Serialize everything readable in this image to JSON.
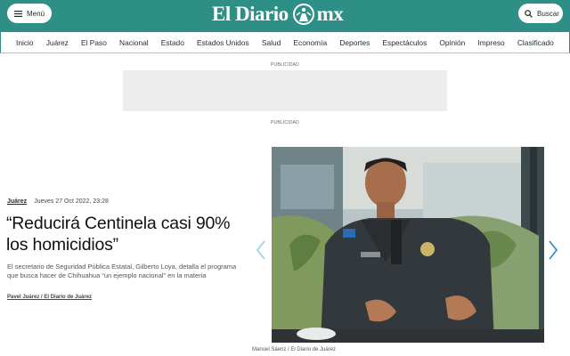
{
  "header": {
    "menu_label": "Menú",
    "search_label": "Buscar",
    "logo_left": "El Diario",
    "logo_right": "mx"
  },
  "nav": {
    "items": [
      "Inicio",
      "Juárez",
      "El Paso",
      "Nacional",
      "Estado",
      "Estados Unidos",
      "Salud",
      "Economía",
      "Deportes",
      "Espectáculos",
      "Opinión",
      "Impreso",
      "Clasificado"
    ]
  },
  "ads": {
    "label_top": "PUBLICIDAD",
    "label_bottom": "PUBLICIDAD"
  },
  "article": {
    "section": "Juárez",
    "date": "Jueves 27 Oct 2022, 23:28",
    "headline": "“Reducirá Centinela casi 90% los homicidios”",
    "summary": "El secretario de Seguridad Pública Estatal, Gilberto Loya, detalla el programa que busca hacer de Chihuahua “un ejemplo nacional” en la materia",
    "byline": "Pavel Juárez / El Diario de Juárez",
    "photo_caption": "Manuel Sáenz / El Diario de Juárez"
  },
  "colors": {
    "brand": "#2d8f86",
    "arrow": "#4aa3d8"
  },
  "icons": {
    "menu": "hamburger-icon",
    "search": "search-icon",
    "prev": "chevron-left-icon",
    "next": "chevron-right-icon"
  }
}
